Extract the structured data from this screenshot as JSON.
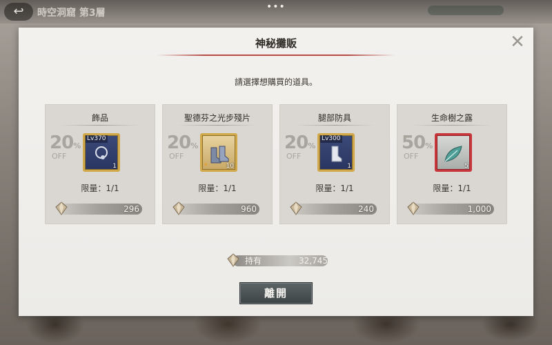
{
  "header": {
    "back_icon": "back-arrow-icon",
    "stage_title": "時空洞窟 第3層",
    "menu_dots": "•••"
  },
  "dialog": {
    "title": "神秘攤販",
    "close_icon": "close-icon",
    "instruction": "請選擇想購買的道具。",
    "items": [
      {
        "name": "飾品",
        "discount_pct": "20",
        "pct_symbol": "%",
        "off_label": "OFF",
        "level": "Lv370",
        "quantity": "1",
        "icon": "necklace-icon",
        "frame": "gold",
        "limit": "限量：1/1",
        "price": "296"
      },
      {
        "name": "聖德芬之光步殘片",
        "discount_pct": "20",
        "pct_symbol": "%",
        "off_label": "OFF",
        "level": "",
        "quantity": "10",
        "icon": "boots-icon",
        "frame": "gold",
        "limit": "限量：1/1",
        "price": "960"
      },
      {
        "name": "腿部防具",
        "discount_pct": "20",
        "pct_symbol": "%",
        "off_label": "OFF",
        "level": "Lv300",
        "quantity": "1",
        "icon": "leg-armor-icon",
        "frame": "gold",
        "limit": "限量：1/1",
        "price": "240"
      },
      {
        "name": "生命樹之露",
        "discount_pct": "50",
        "pct_symbol": "%",
        "off_label": "OFF",
        "level": "",
        "quantity": "5",
        "icon": "leaf-icon",
        "frame": "red",
        "limit": "限量：1/1",
        "price": "1,000"
      }
    ],
    "holdings": {
      "label": "持有",
      "value": "32,745",
      "icon": "gem-currency-icon"
    },
    "leave_button": "離開"
  },
  "colors": {
    "title_rule": "#b44a43",
    "gold_frame": "#d2a94a",
    "red_frame": "#c8363c",
    "button_bg": "#4b5355"
  }
}
